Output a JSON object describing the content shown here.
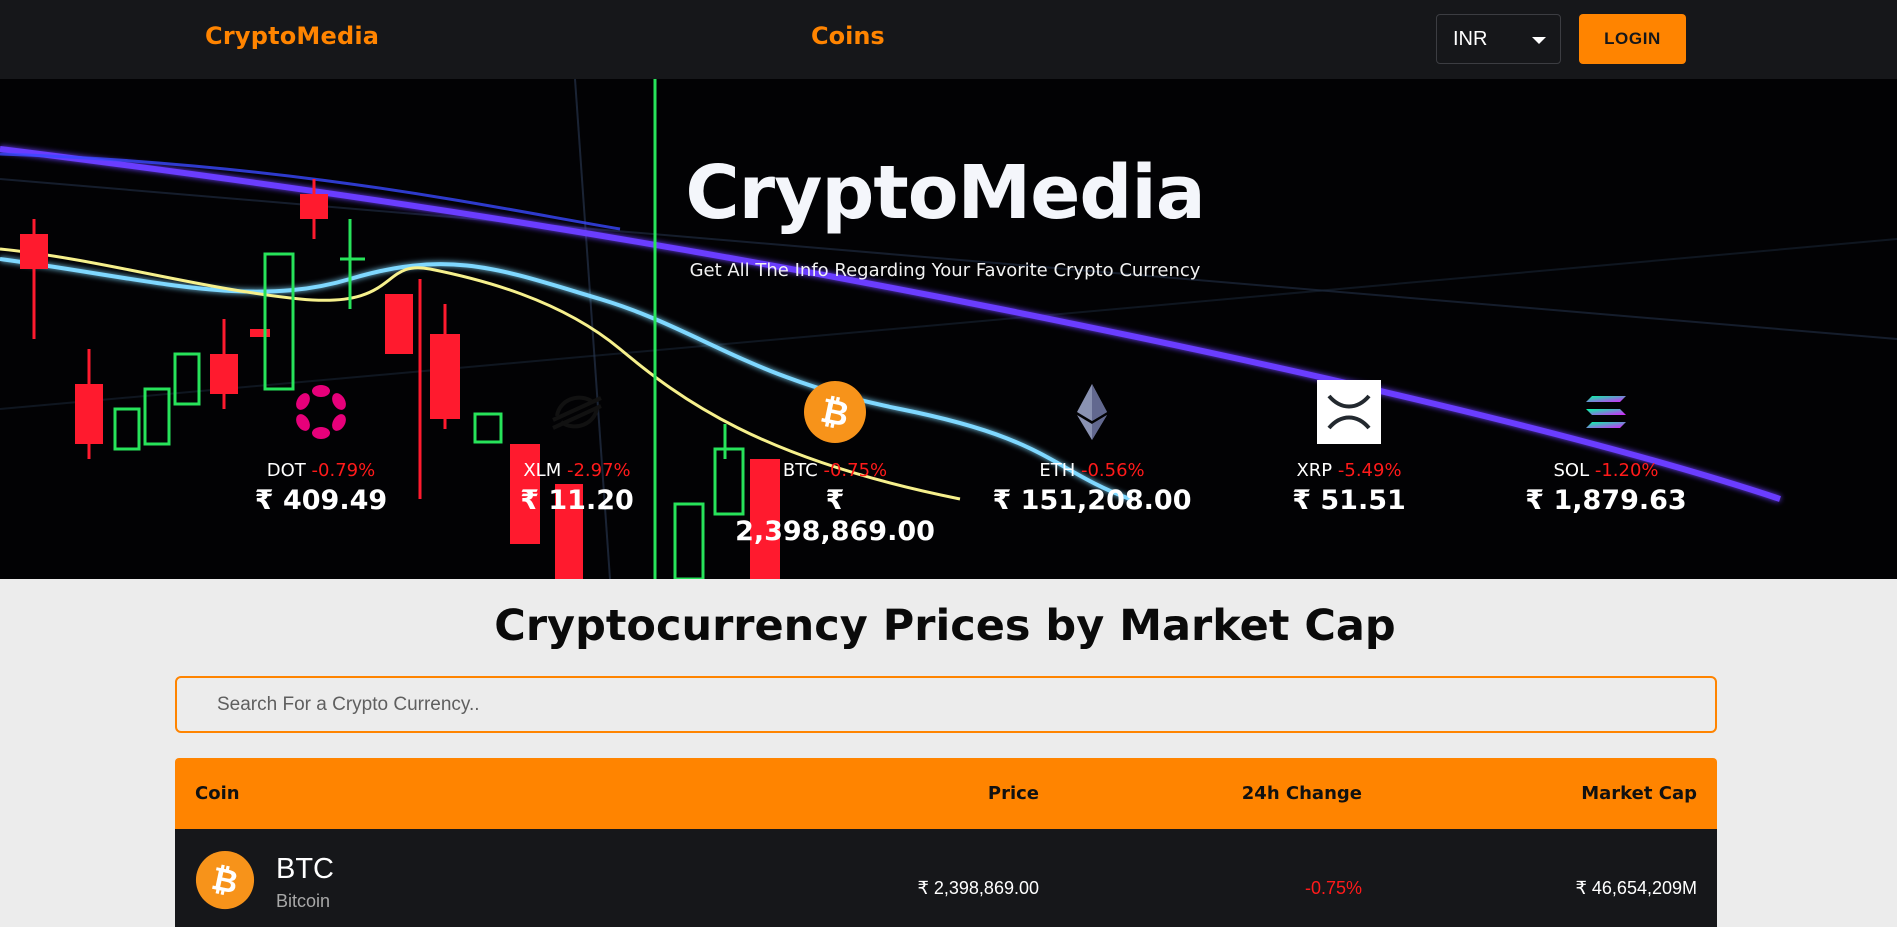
{
  "navbar": {
    "brand": "CryptoMedia",
    "coins_link": "Coins",
    "currency": "INR",
    "login_label": "LOGIN"
  },
  "hero": {
    "title": "CryptoMedia",
    "subtitle": "Get All The Info Regarding Your Favorite Crypto Currency",
    "carousel": [
      {
        "symbol": "DOT",
        "change": "-0.79%",
        "price": "₹ 409.49",
        "icon": "polkadot-icon"
      },
      {
        "symbol": "XLM",
        "change": "-2.97%",
        "price": "₹ 11.20",
        "icon": "stellar-icon"
      },
      {
        "symbol": "BTC",
        "change": "-0.75%",
        "price": "₹ 2,398,869.00",
        "icon": "bitcoin-icon"
      },
      {
        "symbol": "ETH",
        "change": "-0.56%",
        "price": "₹ 151,208.00",
        "icon": "ethereum-icon"
      },
      {
        "symbol": "XRP",
        "change": "-5.49%",
        "price": "₹ 51.51",
        "icon": "xrp-icon"
      },
      {
        "symbol": "SOL",
        "change": "-1.20%",
        "price": "₹ 1,879.63",
        "icon": "solana-icon"
      }
    ]
  },
  "main": {
    "heading": "Cryptocurrency Prices by Market Cap",
    "search_placeholder": "Search For a Crypto Currency..",
    "table": {
      "headers": {
        "coin": "Coin",
        "price": "Price",
        "change": "24h Change",
        "market_cap": "Market Cap"
      },
      "rows": [
        {
          "symbol": "BTC",
          "name": "Bitcoin",
          "price": "₹ 2,398,869.00",
          "change": "-0.75%",
          "market_cap": "₹ 46,654,209M",
          "icon": "bitcoin-icon"
        }
      ]
    }
  },
  "colors": {
    "accent": "#ff8400",
    "navbar_bg": "#16171a",
    "negative": "#ff1a1a",
    "page_bg": "#ececec"
  }
}
